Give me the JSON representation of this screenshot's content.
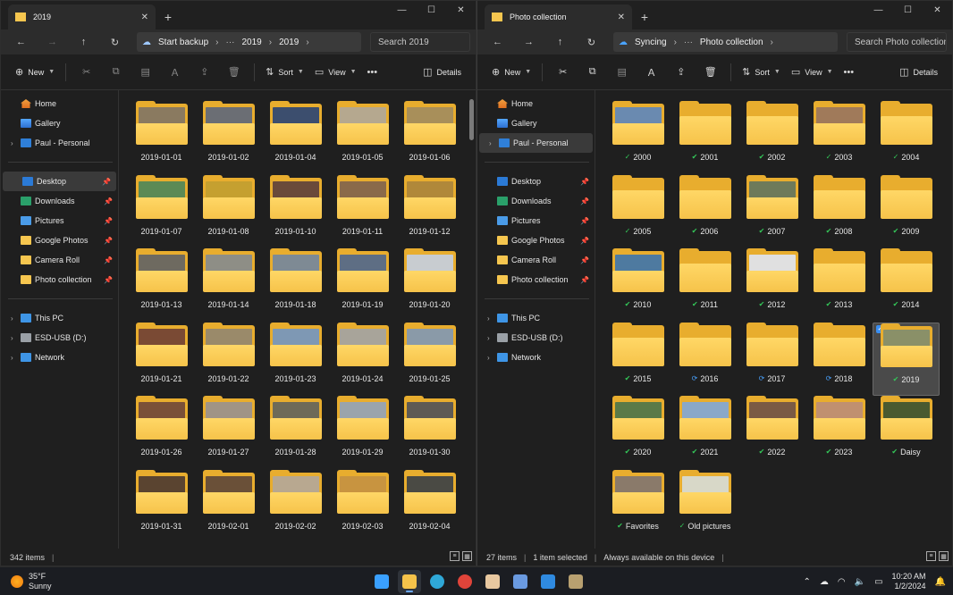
{
  "left": {
    "tab_title": "2019",
    "address": {
      "status": "Start backup",
      "crumbs": [
        "2019",
        "2019"
      ]
    },
    "search_placeholder": "Search 2019",
    "commands": {
      "new": "New",
      "sort": "Sort",
      "view": "View",
      "details": "Details"
    },
    "sidebar": {
      "top": [
        {
          "label": "Home",
          "icon": "home-icon"
        },
        {
          "label": "Gallery",
          "icon": "gallery-icon"
        },
        {
          "label": "Paul - Personal",
          "icon": "onedrive-icon",
          "expandable": true
        }
      ],
      "pinned": [
        {
          "label": "Desktop",
          "icon": "desktop-icon",
          "selected": true
        },
        {
          "label": "Downloads",
          "icon": "downloads-icon"
        },
        {
          "label": "Pictures",
          "icon": "pictures-icon"
        },
        {
          "label": "Google Photos",
          "icon": "folder-icon"
        },
        {
          "label": "Camera Roll",
          "icon": "folder-icon"
        },
        {
          "label": "Photo collection",
          "icon": "folder-icon"
        }
      ],
      "devices": [
        {
          "label": "This PC",
          "icon": "pc-icon"
        },
        {
          "label": "ESD-USB (D:)",
          "icon": "usb-drive-icon"
        },
        {
          "label": "Network",
          "icon": "network-icon"
        }
      ]
    },
    "items": [
      {
        "name": "2019-01-01",
        "photo": "#8a7a60"
      },
      {
        "name": "2019-01-02",
        "photo": "#6b6e74"
      },
      {
        "name": "2019-01-04",
        "photo": "#3c4e6e"
      },
      {
        "name": "2019-01-05",
        "photo": "#b5a88f"
      },
      {
        "name": "2019-01-06",
        "photo": "#a88f5a"
      },
      {
        "name": "2019-01-07",
        "photo": "#5c8a55"
      },
      {
        "name": "2019-01-08",
        "photo": "#c5a030"
      },
      {
        "name": "2019-01-10",
        "photo": "#6a4a3a"
      },
      {
        "name": "2019-01-11",
        "photo": "#8a6a4a"
      },
      {
        "name": "2019-01-12",
        "photo": "#b0883a"
      },
      {
        "name": "2019-01-13",
        "photo": "#6e6a60"
      },
      {
        "name": "2019-01-14",
        "photo": "#8e8e86"
      },
      {
        "name": "2019-01-18",
        "photo": "#7e8a94"
      },
      {
        "name": "2019-01-19",
        "photo": "#5e6e84"
      },
      {
        "name": "2019-01-20",
        "photo": "#c8ccd0"
      },
      {
        "name": "2019-01-21",
        "photo": "#7a4a34"
      },
      {
        "name": "2019-01-22",
        "photo": "#9a8a6a"
      },
      {
        "name": "2019-01-23",
        "photo": "#7e98b4"
      },
      {
        "name": "2019-01-24",
        "photo": "#a8a49a"
      },
      {
        "name": "2019-01-25",
        "photo": "#8a9aa8"
      },
      {
        "name": "2019-01-26",
        "photo": "#7a5038"
      },
      {
        "name": "2019-01-27",
        "photo": "#a09486"
      },
      {
        "name": "2019-01-28",
        "photo": "#6e6a58"
      },
      {
        "name": "2019-01-29",
        "photo": "#9aa4ac"
      },
      {
        "name": "2019-01-30",
        "photo": "#5e5a54"
      },
      {
        "name": "2019-01-31",
        "photo": "#5a4430"
      },
      {
        "name": "2019-02-01",
        "photo": "#6a5038"
      },
      {
        "name": "2019-02-02",
        "photo": "#b8a890"
      },
      {
        "name": "2019-02-03",
        "photo": "#c89440"
      },
      {
        "name": "2019-02-04",
        "photo": "#4a4a44"
      }
    ],
    "status": {
      "count": "342 items"
    }
  },
  "right": {
    "tab_title": "Photo collection",
    "address": {
      "status": "Syncing",
      "crumbs": [
        "Photo collection"
      ]
    },
    "search_placeholder": "Search Photo collection",
    "commands": {
      "new": "New",
      "sort": "Sort",
      "view": "View",
      "details": "Details"
    },
    "sidebar": {
      "top": [
        {
          "label": "Home",
          "icon": "home-icon"
        },
        {
          "label": "Gallery",
          "icon": "gallery-icon"
        },
        {
          "label": "Paul - Personal",
          "icon": "onedrive-icon",
          "expandable": true,
          "selected": true
        }
      ],
      "pinned": [
        {
          "label": "Desktop",
          "icon": "desktop-icon"
        },
        {
          "label": "Downloads",
          "icon": "downloads-icon"
        },
        {
          "label": "Pictures",
          "icon": "pictures-icon"
        },
        {
          "label": "Google Photos",
          "icon": "folder-icon"
        },
        {
          "label": "Camera Roll",
          "icon": "folder-icon"
        },
        {
          "label": "Photo collection",
          "icon": "folder-icon"
        }
      ],
      "devices": [
        {
          "label": "This PC",
          "icon": "pc-icon"
        },
        {
          "label": "ESD-USB (D:)",
          "icon": "usb-drive-icon"
        },
        {
          "label": "Network",
          "icon": "network-icon"
        }
      ]
    },
    "items": [
      {
        "name": "2000",
        "status": "outline",
        "photo": "#6a8ab0"
      },
      {
        "name": "2001",
        "status": "ok"
      },
      {
        "name": "2002",
        "status": "ok"
      },
      {
        "name": "2003",
        "status": "outline",
        "photo": "#a07a5a"
      },
      {
        "name": "2004",
        "status": "outline"
      },
      {
        "name": "2005",
        "status": "outline"
      },
      {
        "name": "2006",
        "status": "ok"
      },
      {
        "name": "2007",
        "status": "ok",
        "photo": "#6e7a5a"
      },
      {
        "name": "2008",
        "status": "ok"
      },
      {
        "name": "2009",
        "status": "ok"
      },
      {
        "name": "2010",
        "status": "ok",
        "photo": "#4e7aa0"
      },
      {
        "name": "2011",
        "status": "ok"
      },
      {
        "name": "2012",
        "status": "ok",
        "photo": "#e0e0e0"
      },
      {
        "name": "2013",
        "status": "ok"
      },
      {
        "name": "2014",
        "status": "ok"
      },
      {
        "name": "2015",
        "status": "ok"
      },
      {
        "name": "2016",
        "status": "sync"
      },
      {
        "name": "2017",
        "status": "sync"
      },
      {
        "name": "2018",
        "status": "sync"
      },
      {
        "name": "2019",
        "status": "ok",
        "photo": "#8a9068",
        "selected": true
      },
      {
        "name": "2020",
        "status": "ok",
        "photo": "#5a7a48"
      },
      {
        "name": "2021",
        "status": "ok",
        "photo": "#8aa8c8"
      },
      {
        "name": "2022",
        "status": "ok",
        "photo": "#7a5a44"
      },
      {
        "name": "2023",
        "status": "ok",
        "photo": "#c09070"
      },
      {
        "name": "Daisy",
        "status": "ok",
        "photo": "#4a5a30"
      },
      {
        "name": "Favorites",
        "status": "ok",
        "photo": "#8a7a6a"
      },
      {
        "name": "Old pictures",
        "status": "outline",
        "photo": "#d8d8c8"
      }
    ],
    "status": {
      "count": "27 items",
      "selected": "1 item selected",
      "availability": "Always available on this device"
    }
  },
  "taskbar": {
    "weather": {
      "temp": "35°F",
      "condition": "Sunny"
    },
    "apps": [
      {
        "name": "start-icon",
        "color": "#3aa0ff"
      },
      {
        "name": "file-explorer-icon",
        "color": "#f6c34a",
        "active": true
      },
      {
        "name": "edge-icon",
        "color": "#2fa8d8"
      },
      {
        "name": "chrome-icon",
        "color": "#e0443a"
      },
      {
        "name": "paint-icon",
        "color": "#e8c8a0"
      },
      {
        "name": "remote-desktop-icon",
        "color": "#6a9ae0"
      },
      {
        "name": "store-icon",
        "color": "#2f8ae0"
      },
      {
        "name": "photos-icon",
        "color": "#b8a070"
      }
    ],
    "clock": {
      "time": "10:20 AM",
      "date": "1/2/2024"
    }
  }
}
